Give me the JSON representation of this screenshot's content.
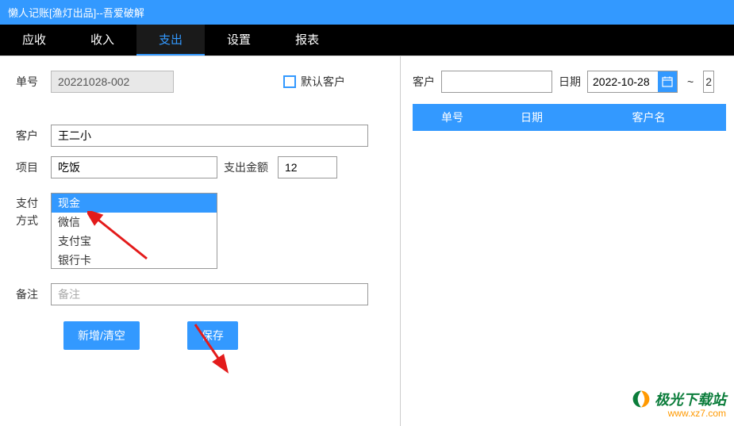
{
  "titlebar": "懒人记账[渔灯出品]--吾爱破解",
  "nav": {
    "items": [
      "应收",
      "收入",
      "支出",
      "设置",
      "报表"
    ],
    "activeIndex": 2
  },
  "form": {
    "orderNo_label": "单号",
    "orderNo_value": "20221028-002",
    "defaultCustomer_label": "默认客户",
    "customer_label": "客户",
    "customer_value": "王二小",
    "project_label": "项目",
    "project_value": "吃饭",
    "amount_label": "支出金额",
    "amount_value": "12",
    "payment_label": "支付方式",
    "payment_options": [
      "现金",
      "微信",
      "支付宝",
      "银行卡"
    ],
    "payment_selected": 0,
    "remark_label": "备注",
    "remark_placeholder": "备注",
    "remark_value": "",
    "btn_new": "新增/清空",
    "btn_save": "保存"
  },
  "right": {
    "customer_label": "客户",
    "customer_value": "",
    "date_label": "日期",
    "date_from": "2022-10-28",
    "tilde": "~",
    "date_to_partial": "2",
    "table_headers": [
      "单号",
      "日期",
      "客户名"
    ]
  },
  "watermark": {
    "brand": "极光下载站",
    "url": "www.xz7.com"
  }
}
